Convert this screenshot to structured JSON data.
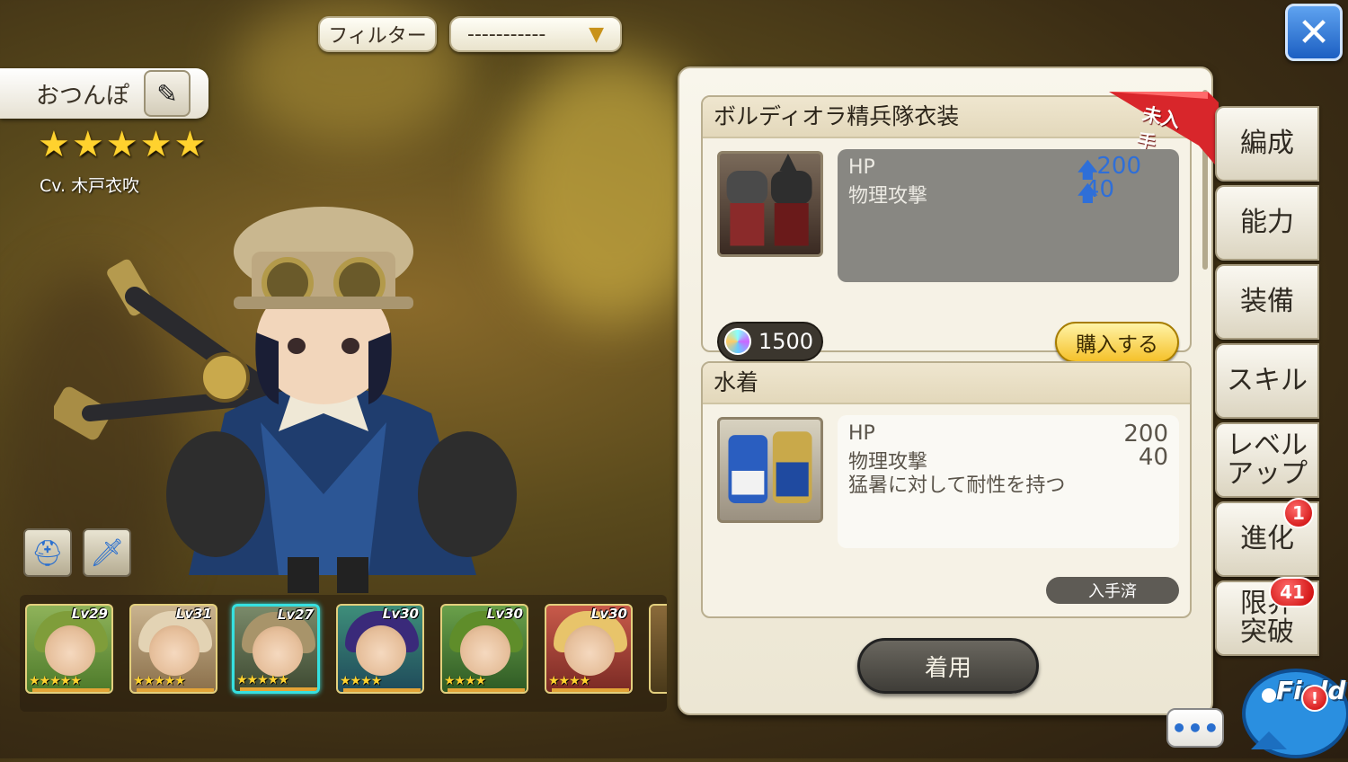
{
  "top_bar": {
    "filter_label": "フィルター",
    "dropdown_value": "-----------",
    "close_icon": "close-icon"
  },
  "character": {
    "name": "おつんぽ",
    "stars": "★★★★★",
    "cv": "Cv. 木戸衣吹"
  },
  "equip_slots": [
    {
      "icon": "hat-icon"
    },
    {
      "icon": "sword-icon"
    }
  ],
  "roster": [
    {
      "level": "Lv29",
      "stars": "★★★★★",
      "selected": false
    },
    {
      "level": "Lv31",
      "stars": "★★★★★",
      "selected": false
    },
    {
      "level": "Lv27",
      "stars": "★★★★★",
      "selected": true
    },
    {
      "level": "Lv30",
      "stars": "★★★★",
      "selected": false
    },
    {
      "level": "Lv30",
      "stars": "★★★★",
      "selected": false
    },
    {
      "level": "Lv30",
      "stars": "★★★★",
      "selected": false
    }
  ],
  "costumes": [
    {
      "name": "ボルディオラ精兵隊衣装",
      "ribbon": "未入手",
      "stat1_label": "HP",
      "stat1_value": "200",
      "stat2_label": "物理攻撃",
      "stat2_value": "40",
      "cost": "1500",
      "buy_label": "購入する"
    },
    {
      "name": "水着",
      "stat1_label": "HP",
      "stat1_value": "200",
      "stat2_label": "物理攻撃",
      "stat2_value": "40",
      "effect": "猛暑に対して耐性を持つ",
      "status": "入手済"
    }
  ],
  "equip_button": "着用",
  "side_tabs": [
    {
      "label": "編成"
    },
    {
      "label": "能力"
    },
    {
      "label": "装備"
    },
    {
      "label": "スキル"
    },
    {
      "label": "レベル\nアップ"
    },
    {
      "label": "進化",
      "badge": "1"
    },
    {
      "label": "限界\n突破",
      "badge": "41"
    }
  ],
  "field_button": {
    "label": "Field",
    "badge": "!"
  },
  "chat_button": "•••",
  "colors": {
    "accent_blue": "#1c5fc2",
    "badge_red": "#c80000",
    "buy_yellow": "#f5c12a",
    "ribbon_red": "#d8262b"
  }
}
